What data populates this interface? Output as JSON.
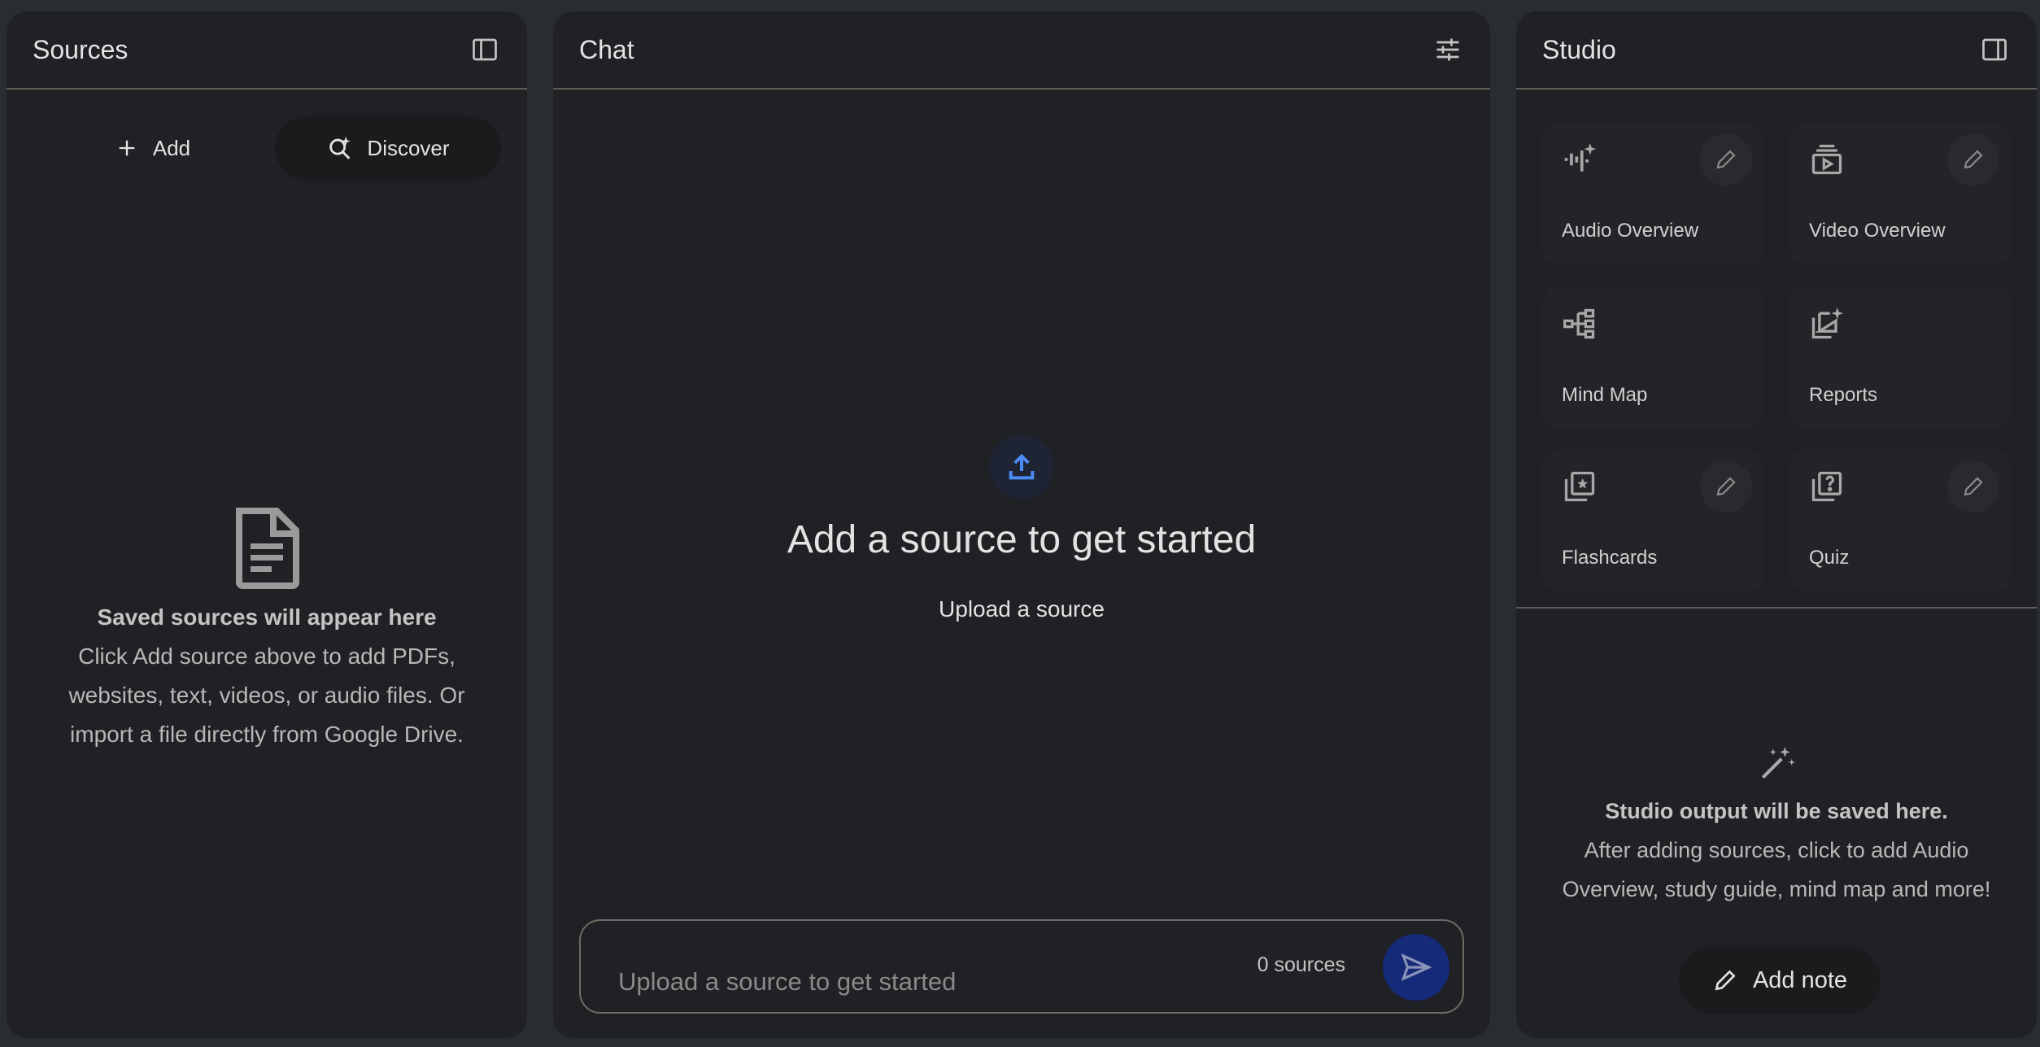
{
  "sources": {
    "title": "Sources",
    "add_label": "Add",
    "discover_label": "Discover",
    "empty_title": "Saved sources will appear here",
    "empty_body": "Click Add source above to add PDFs, websites, text, videos, or audio files. Or import a file directly from Google Drive."
  },
  "chat": {
    "title": "Chat",
    "heading": "Add a source to get started",
    "upload_link": "Upload a source",
    "input_placeholder": "Upload a source to get started",
    "source_count": "0 sources"
  },
  "studio": {
    "title": "Studio",
    "tiles": [
      {
        "label": "Audio Overview",
        "icon": "audio-waveform-icon",
        "editable": true
      },
      {
        "label": "Video Overview",
        "icon": "video-stack-icon",
        "editable": true
      },
      {
        "label": "Mind Map",
        "icon": "mind-map-icon",
        "editable": false
      },
      {
        "label": "Reports",
        "icon": "reports-icon",
        "editable": false
      },
      {
        "label": "Flashcards",
        "icon": "flashcards-icon",
        "editable": true
      },
      {
        "label": "Quiz",
        "icon": "quiz-icon",
        "editable": true
      }
    ],
    "empty_title": "Studio output will be saved here.",
    "empty_body": "After adding sources, click to add Audio Overview, study guide, mind map and more!",
    "add_note_label": "Add note"
  },
  "colors": {
    "background": "#2a2d30",
    "panel": "#202124",
    "accent_blue": "#4a8af4",
    "send_button": "#162a7a"
  }
}
